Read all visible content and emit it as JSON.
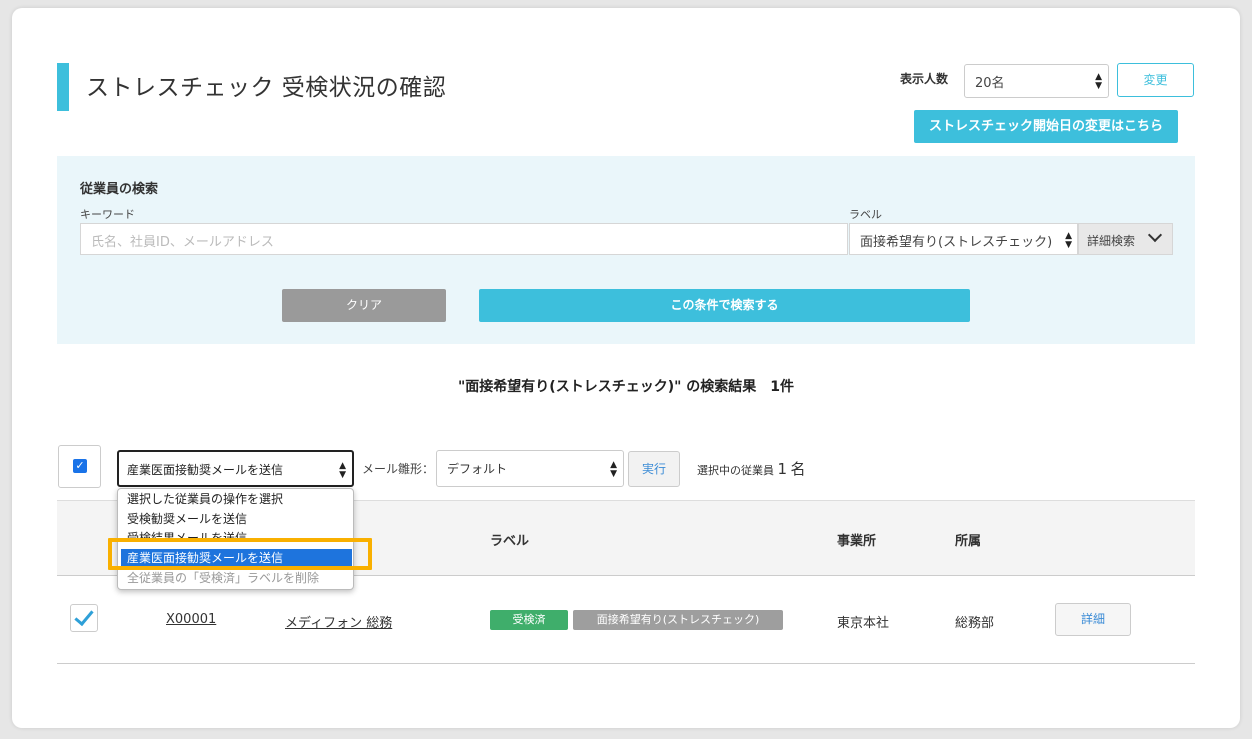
{
  "page_title": "ストレスチェック 受検状況の確認",
  "display": {
    "label": "表示人数",
    "value": "20名",
    "change_button": "変更",
    "start_date_button": "ストレスチェック開始日の変更はこちら"
  },
  "search": {
    "title": "従業員の検索",
    "keyword_label": "キーワード",
    "keyword_placeholder": "氏名、社員ID、メールアドレス",
    "label_label": "ラベル",
    "label_value": "面接希望有り(ストレスチェック)",
    "advanced_button": "詳細検索",
    "clear_button": "クリア",
    "search_button": "この条件で検索する"
  },
  "result_summary": "\"面接希望有り(ストレスチェック)\" の検索結果　1件",
  "bulk": {
    "action_value": "産業医面接勧奨メールを送信",
    "mail_template_label": "メール雛形：",
    "mail_template_value": "デフォルト",
    "exec_button": "実行",
    "selected_label": "選択中の従業員",
    "selected_count": "1",
    "selected_unit": "名"
  },
  "action_options": [
    "選択した従業員の操作を選択",
    "受検勧奨メールを送信",
    "受検結果メールを送信",
    "産業医面接勧奨メールを送信",
    "全従業員の「受検済」ラベルを削除"
  ],
  "table": {
    "headers": {
      "label": "ラベル",
      "office": "事業所",
      "dept": "所属"
    },
    "rows": [
      {
        "id": "X00001",
        "name": "メディフォン 総務",
        "badges": [
          "受検済",
          "面接希望有り(ストレスチェック)"
        ],
        "office": "東京本社",
        "dept": "総務部",
        "detail_button": "詳細"
      }
    ]
  },
  "colors": {
    "accent": "#3dbfdc",
    "highlight": "#f9b000",
    "badge_done": "#3fae6b",
    "badge_label": "#9e9e9e"
  }
}
